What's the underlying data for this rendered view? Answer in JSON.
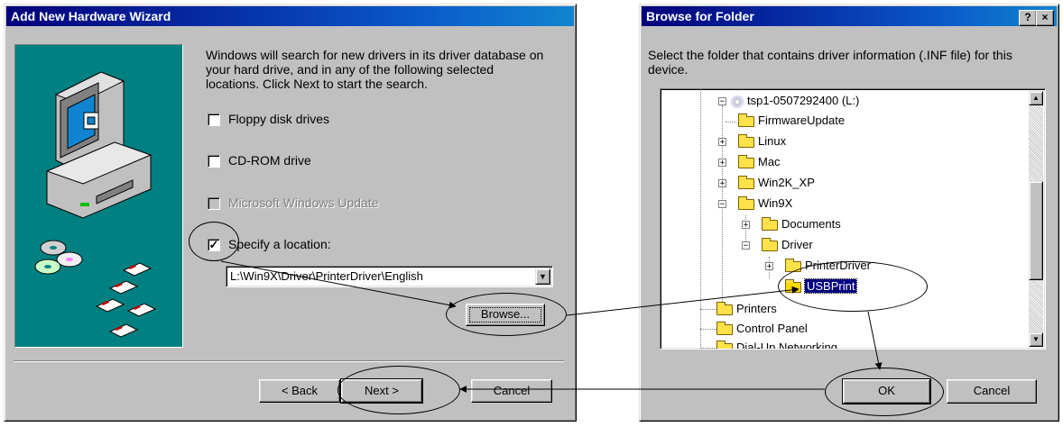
{
  "wizard": {
    "title": "Add New Hardware Wizard",
    "description": "Windows will search for new drivers in its driver database on your hard drive, and in any of the following selected locations. Click Next to start the search.",
    "options": [
      {
        "label": "Floppy disk drives",
        "checked": false,
        "enabled": true
      },
      {
        "label": "CD-ROM drive",
        "checked": false,
        "enabled": true
      },
      {
        "label": "Microsoft Windows Update",
        "checked": false,
        "enabled": false
      },
      {
        "label": "Specify a location:",
        "checked": true,
        "enabled": true
      }
    ],
    "location_value": "L:\\Win9X\\Driver\\PrinterDriver\\English",
    "browse_label": "Browse...",
    "back_label": "< Back",
    "next_label": "Next >",
    "cancel_label": "Cancel"
  },
  "browse": {
    "title": "Browse for Folder",
    "help_btn": "?",
    "close_btn": "×",
    "description": "Select the folder that contains driver information (.INF file) for this device.",
    "tree": [
      {
        "label": "tsp1-0507292400 (L:)"
      },
      {
        "label": "FirmwareUpdate"
      },
      {
        "label": "Linux"
      },
      {
        "label": "Mac"
      },
      {
        "label": "Win2K_XP"
      },
      {
        "label": "Win9X"
      },
      {
        "label": "Documents"
      },
      {
        "label": "Driver"
      },
      {
        "label": "PrinterDriver"
      },
      {
        "label": "USBPrint",
        "selected": true
      },
      {
        "label": "Printers"
      },
      {
        "label": "Control Panel"
      },
      {
        "label": "Dial-Up Networking"
      }
    ],
    "ok_label": "OK",
    "cancel_label": "Cancel"
  },
  "colors": {
    "title_start": "#00007b",
    "title_end": "#1084d0",
    "teal": "#008080",
    "dialog": "#c0c0c0",
    "selection": "#000080"
  }
}
